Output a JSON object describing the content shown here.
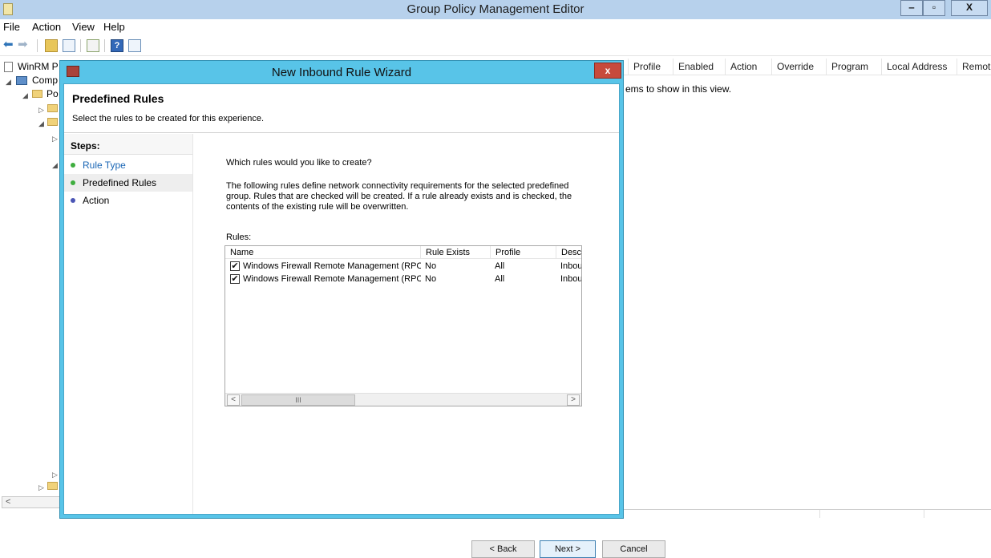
{
  "window": {
    "title": "Group Policy Management Editor",
    "min_label": "‒",
    "max_label": "▫",
    "close_label": "X"
  },
  "menu": [
    "File",
    "Action",
    "View",
    "Help"
  ],
  "tree": {
    "items": [
      "WinRM P",
      "Comp",
      "Po"
    ]
  },
  "list_pane": {
    "columns": [
      "Profile",
      "Enabled",
      "Action",
      "Override",
      "Program",
      "Local Address",
      "Remot"
    ],
    "empty_message": "ems to show in this view."
  },
  "wizard": {
    "title": "New Inbound Rule Wizard",
    "close_label": "x",
    "heading": "Predefined Rules",
    "subheading": "Select the rules to be created for this experience.",
    "steps_title": "Steps:",
    "steps": [
      {
        "label": "Rule Type",
        "state": "done"
      },
      {
        "label": "Predefined Rules",
        "state": "current"
      },
      {
        "label": "Action",
        "state": "pending"
      }
    ],
    "question": "Which rules would you like to create?",
    "description": "The following rules define network connectivity requirements for the selected predefined group. Rules that are checked will be created. If a rule already exists and is checked, the contents of the existing rule will be overwritten.",
    "rules_label": "Rules:",
    "rules_columns": [
      "Name",
      "Rule Exists",
      "Profile",
      "Desc"
    ],
    "rules": [
      {
        "name": "Windows Firewall Remote Management (RPC...",
        "exists": "No",
        "profile": "All",
        "desc": "Inbou",
        "checked": true
      },
      {
        "name": "Windows Firewall Remote Management (RPC)",
        "exists": "No",
        "profile": "All",
        "desc": "Inbou",
        "checked": true
      }
    ],
    "scroll_thumb": "III",
    "buttons": {
      "back": "< Back",
      "next": "Next >",
      "cancel": "Cancel"
    }
  },
  "colors": {
    "titlebar": "#b7d1ec",
    "wizard_frame": "#58c4e8",
    "step_done": "#3fae3f",
    "step_pending": "#4a55b5",
    "link": "#1a66b5"
  }
}
